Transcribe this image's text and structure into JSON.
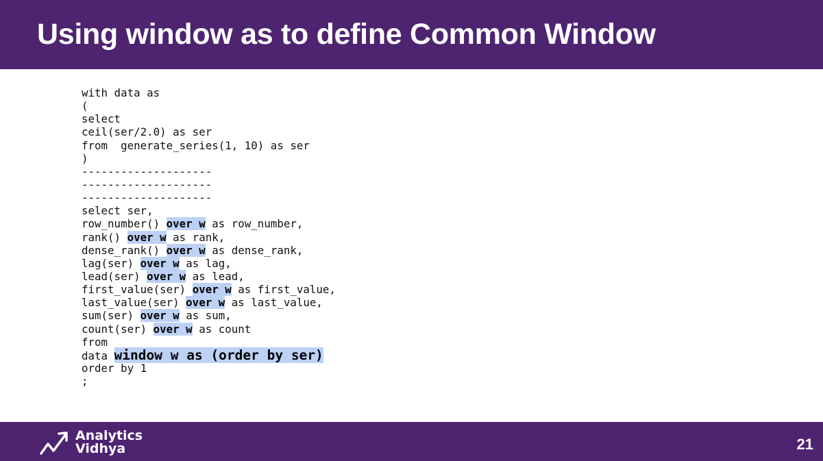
{
  "slide": {
    "title": "Using window as to define Common Window",
    "page_number": "21"
  },
  "brand": {
    "line1": "Analytics",
    "line2": "Vidhya"
  },
  "colors": {
    "header": "#4e2370",
    "highlight": "#bdd1f4"
  },
  "icons": {
    "logo": "analytics-vidhya-logo-icon"
  },
  "code": {
    "lines": [
      [
        {
          "t": "with data as"
        }
      ],
      [
        {
          "t": "("
        }
      ],
      [
        {
          "t": "select"
        }
      ],
      [
        {
          "t": "ceil(ser/2.0) as ser"
        }
      ],
      [
        {
          "t": "from  generate_series(1, 10) as ser"
        }
      ],
      [
        {
          "t": ")"
        }
      ],
      [
        {
          "t": "--------------------"
        }
      ],
      [
        {
          "t": "--------------------"
        }
      ],
      [
        {
          "t": "--------------------"
        }
      ],
      [
        {
          "t": "select ser,"
        }
      ],
      [
        {
          "t": "row_number() "
        },
        {
          "t": "over w",
          "h": 1
        },
        {
          "t": " as row_number,"
        }
      ],
      [
        {
          "t": "rank() "
        },
        {
          "t": "over w",
          "h": 1
        },
        {
          "t": " as rank,"
        }
      ],
      [
        {
          "t": "dense_rank() "
        },
        {
          "t": "over w",
          "h": 1
        },
        {
          "t": " as dense_rank,"
        }
      ],
      [
        {
          "t": "lag(ser) "
        },
        {
          "t": "over w",
          "h": 1
        },
        {
          "t": " as lag,"
        }
      ],
      [
        {
          "t": "lead(ser) "
        },
        {
          "t": "over w",
          "h": 1
        },
        {
          "t": " as lead,"
        }
      ],
      [
        {
          "t": "first_value(ser) "
        },
        {
          "t": "over w",
          "h": 1
        },
        {
          "t": " as first_value,"
        }
      ],
      [
        {
          "t": "last_value(ser) "
        },
        {
          "t": "over w",
          "h": 1
        },
        {
          "t": " as last_value,"
        }
      ],
      [
        {
          "t": "sum(ser) "
        },
        {
          "t": "over w",
          "h": 1
        },
        {
          "t": " as sum,"
        }
      ],
      [
        {
          "t": "count(ser) "
        },
        {
          "t": "over w",
          "h": 1
        },
        {
          "t": " as count"
        }
      ],
      [
        {
          "t": "from"
        }
      ],
      [
        {
          "t": "data "
        },
        {
          "t": "window w as (order by ser)",
          "h": 2
        }
      ],
      [
        {
          "t": "order by 1"
        }
      ],
      [
        {
          "t": ";"
        }
      ]
    ]
  }
}
